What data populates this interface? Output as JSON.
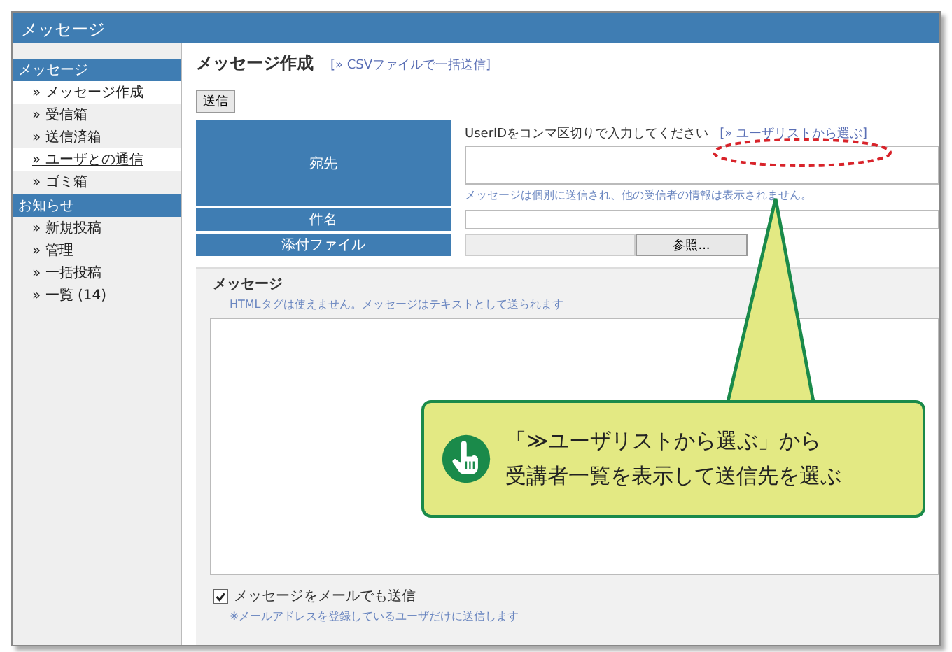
{
  "window": {
    "title": "メッセージ"
  },
  "sidebar": {
    "sections": [
      {
        "heading": "メッセージ",
        "items": [
          {
            "label": "» メッセージ作成",
            "selected": true,
            "underlined": false
          },
          {
            "label": "» 受信箱",
            "selected": false,
            "underlined": false
          },
          {
            "label": "» 送信済箱",
            "selected": false,
            "underlined": false
          },
          {
            "label": "» ユーザとの通信",
            "selected": true,
            "underlined": true
          },
          {
            "label": "» ゴミ箱",
            "selected": false,
            "underlined": false
          }
        ]
      },
      {
        "heading": "お知らせ",
        "items": [
          {
            "label": "» 新規投稿",
            "selected": false,
            "underlined": false
          },
          {
            "label": "» 管理",
            "selected": false,
            "underlined": false
          },
          {
            "label": "» 一括投稿",
            "selected": false,
            "underlined": false
          },
          {
            "label": "» 一覧 (14)",
            "selected": false,
            "underlined": false
          }
        ]
      }
    ]
  },
  "main": {
    "title": "メッセージ作成",
    "csv_link": "[» CSVファイルで一括送信]",
    "send_button": "送信",
    "to": {
      "label": "宛先",
      "instruction": "UserIDをコンマ区切りで入力してください",
      "user_list_link": "[» ユーザリストから選ぶ]",
      "note": "メッセージは個別に送信され、他の受信者の情報は表示されません。"
    },
    "subject": {
      "label": "件名"
    },
    "attachment": {
      "label": "添付ファイル",
      "browse_button": "参照..."
    },
    "message": {
      "label": "メッセージ",
      "note": "HTMLタグは使えません。メッセージはテキストとして送られます"
    },
    "email_copy": {
      "label": "メッセージをメールでも送信",
      "checked": true,
      "note": "※メールアドレスを登録しているユーザだけに送信します"
    }
  },
  "callout": {
    "lines": [
      "「≫ユーザリストから選ぶ」から",
      "受講者一覧を表示して送信先を選ぶ"
    ]
  }
}
